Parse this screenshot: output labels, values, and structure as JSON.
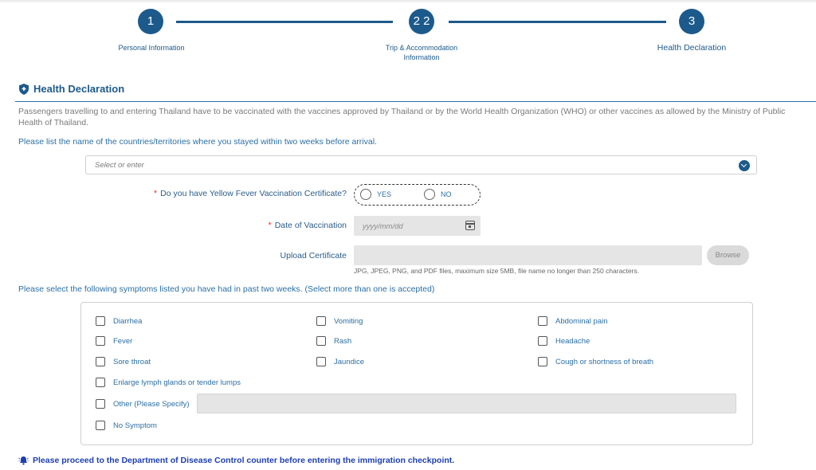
{
  "stepper": {
    "steps": [
      {
        "number": "1",
        "label": "Personal Information"
      },
      {
        "number": "2 2",
        "label_line1": "Trip & Accommodation",
        "label_line2": "Information"
      },
      {
        "number": "3",
        "label": "Health Declaration"
      }
    ]
  },
  "section": {
    "title": "Health Declaration",
    "icon": "shield-icon",
    "intro": "Passengers travelling to and entering Thailand have to be vaccinated with the vaccines approved by Thailand or by the World Health Organization (WHO) or other vaccines as allowed by the Ministry of Public Health of Thailand."
  },
  "countries": {
    "question": "Please list the name of the countries/territories where you stayed within two weeks before arrival.",
    "placeholder": "Select or enter"
  },
  "yellow_fever": {
    "required_mark": "*",
    "label": "Do you have Yellow Fever Vaccination Certificate?",
    "options": [
      "YES",
      "NO"
    ]
  },
  "vaccination_date": {
    "required_mark": "*",
    "label": "Date of Vaccination",
    "placeholder": "yyyy/mm/dd"
  },
  "upload": {
    "label": "Upload Certificate",
    "browse_label": "Browse",
    "hint": "JPG, JPEG, PNG, and PDF files, maximum size 5MB, file name no longer than 250 characters."
  },
  "symptoms": {
    "question": "Please select the following symptoms listed you have had in past two weeks. (Select more than one is accepted)",
    "col1": [
      "Diarrhea",
      "Fever",
      "Sore throat"
    ],
    "col2": [
      "Vomiting",
      "Rash",
      "Jaundice"
    ],
    "col3": [
      "Abdominal pain",
      "Headache",
      "Cough or shortness of breath"
    ],
    "lymph": "Enlarge lymph glands or tender lumps",
    "other": "Other (Please Specify)",
    "none": "No Symptom"
  },
  "notice": {
    "icon": "bell-icon",
    "text": "Please proceed to the Department of Disease Control counter before entering the immigration checkpoint."
  },
  "colors": {
    "primary": "#1d5a8c",
    "link": "#2b6fa6",
    "required": "#e63c3c",
    "notice": "#1d3fb0"
  }
}
